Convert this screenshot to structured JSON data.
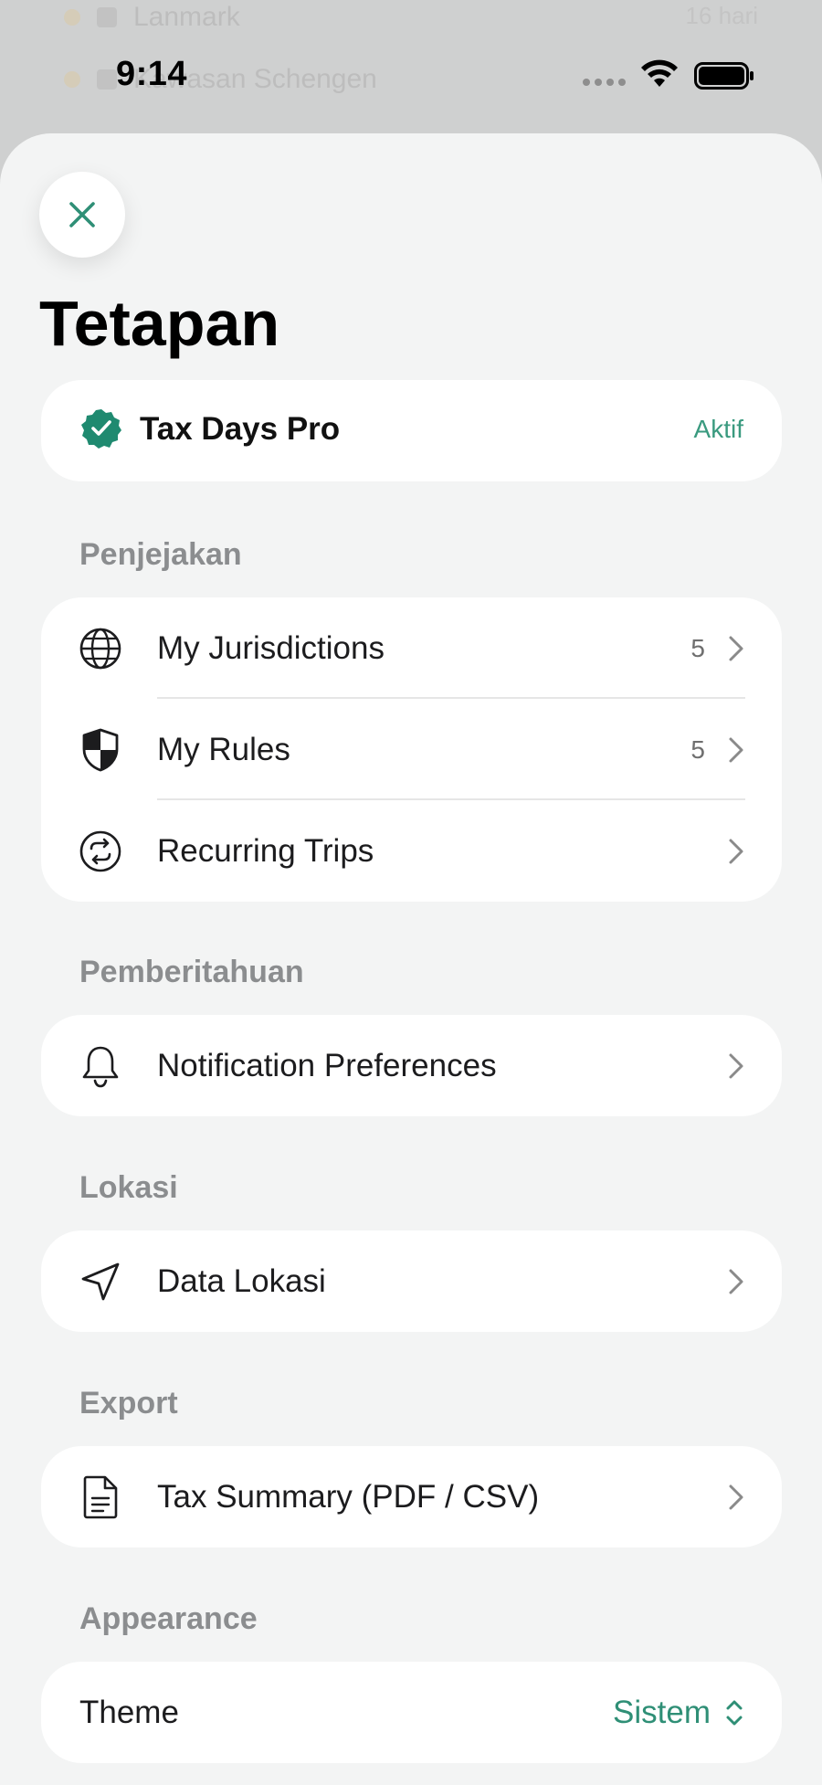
{
  "background_app": {
    "row1_text": "Lanmark",
    "row1_right": "16 hari",
    "row2_text": "Kawasan Schengen"
  },
  "status_bar": {
    "time": "9:14"
  },
  "page_title": "Tetapan",
  "pro": {
    "label": "Tax Days Pro",
    "status": "Aktif"
  },
  "sections": {
    "tracking": {
      "header": "Penjejakan",
      "items": [
        {
          "label": "My Jurisdictions",
          "count": "5",
          "icon": "globe-icon"
        },
        {
          "label": "My Rules",
          "count": "5",
          "icon": "shield-icon"
        },
        {
          "label": "Recurring Trips",
          "count": "",
          "icon": "repeat-icon"
        }
      ]
    },
    "notifications": {
      "header": "Pemberitahuan",
      "items": [
        {
          "label": "Notification Preferences",
          "icon": "bell-icon"
        }
      ]
    },
    "location": {
      "header": "Lokasi",
      "items": [
        {
          "label": "Data Lokasi",
          "icon": "location-arrow-icon"
        }
      ]
    },
    "export": {
      "header": "Export",
      "items": [
        {
          "label": "Tax Summary (PDF / CSV)",
          "icon": "document-icon"
        }
      ]
    },
    "appearance": {
      "header": "Appearance",
      "theme_label": "Theme",
      "theme_value": "Sistem"
    }
  },
  "colors": {
    "accent": "#2f8f76",
    "badge": "#1f8a70",
    "sheet_background": "#f3f4f4",
    "section_header": "#8b8d8f"
  }
}
